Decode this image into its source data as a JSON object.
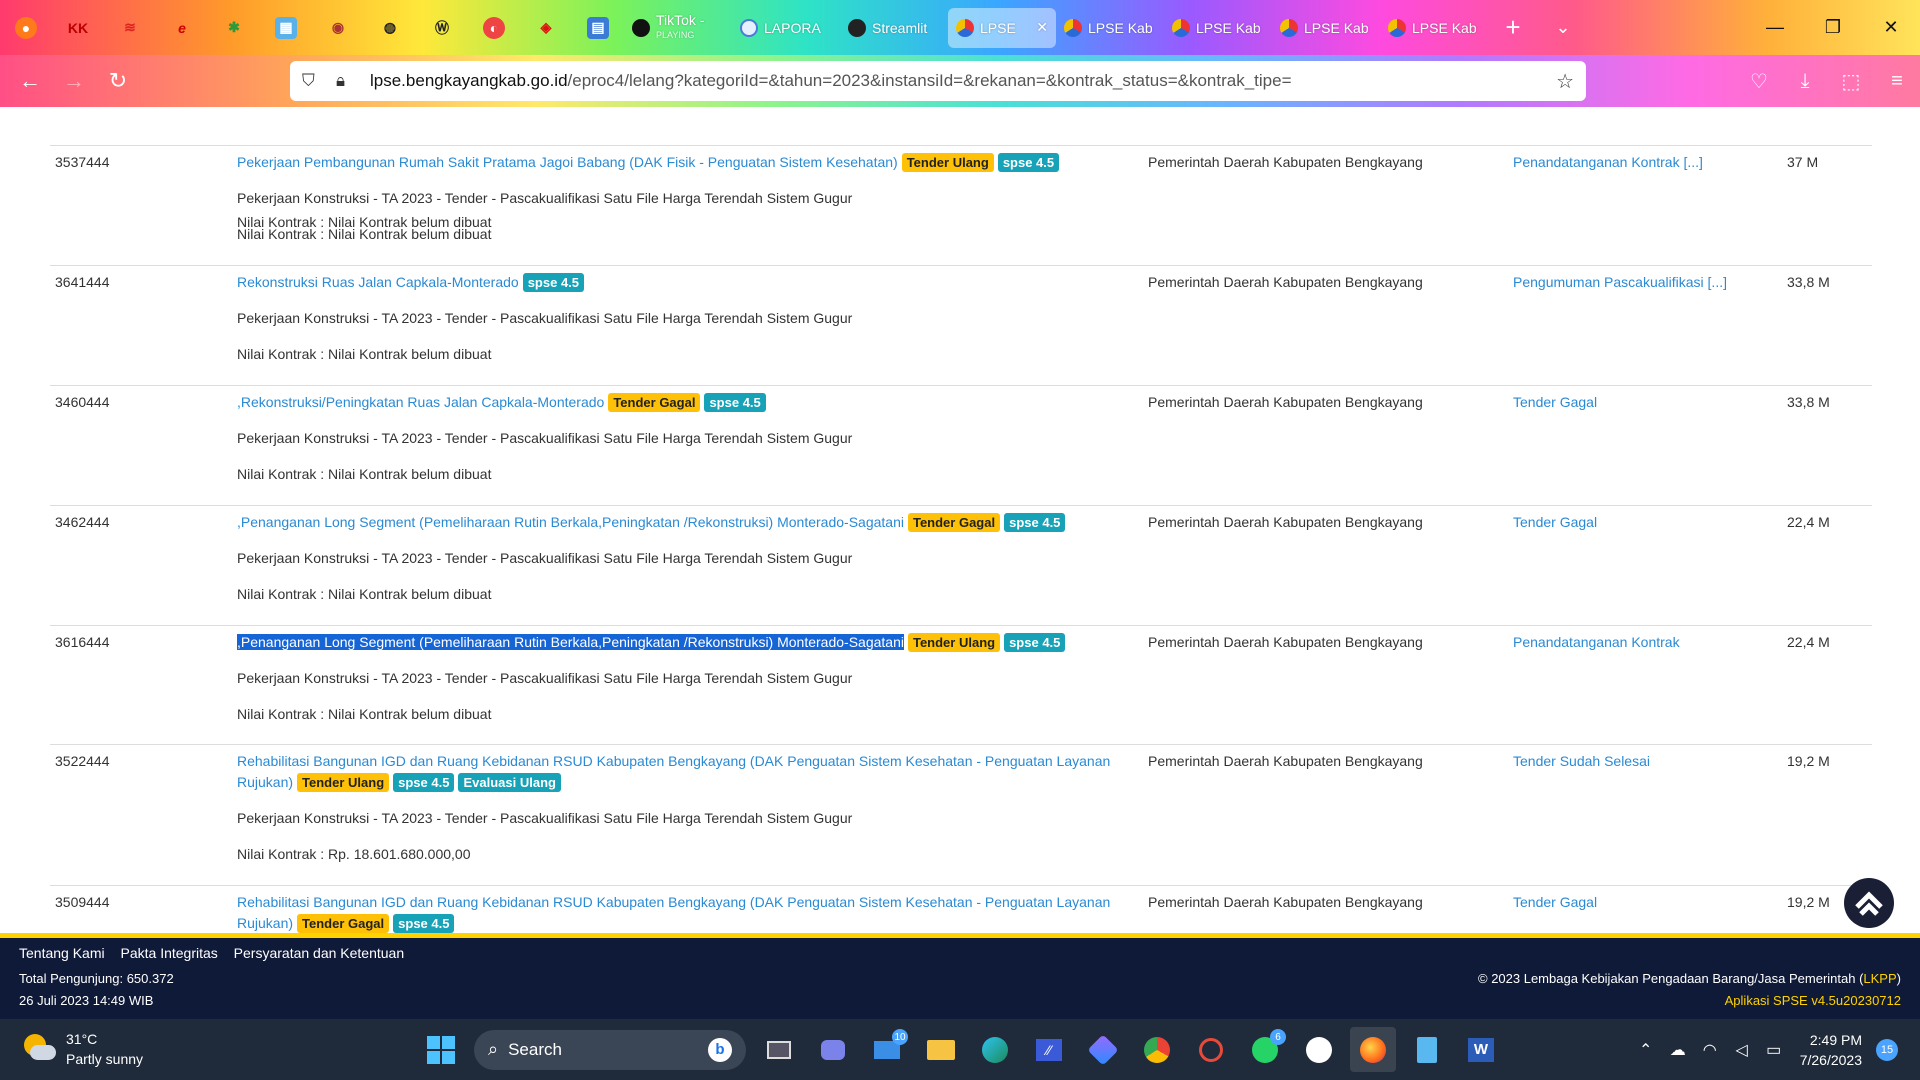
{
  "browser": {
    "tabs": [
      {
        "label": "TikTok - ",
        "sub": "PLAYING",
        "active": false
      },
      {
        "label": "LAPORA",
        "active": false
      },
      {
        "label": "Streamlit",
        "active": false
      },
      {
        "label": "LPSE",
        "active": true
      },
      {
        "label": "LPSE Kab",
        "active": false
      },
      {
        "label": "LPSE Kab",
        "active": false
      },
      {
        "label": "LPSE Kab",
        "active": false
      },
      {
        "label": "LPSE Kab",
        "active": false
      }
    ],
    "url_host": "lpse.bengkayangkab.go.id",
    "url_path": "/eproc4/lelang?kategoriId=&tahun=2023&instansiId=&rekanan=&kontrak_status=&kontrak_tipe="
  },
  "rows": [
    {
      "id": "",
      "name": "",
      "badges": [],
      "desc": "",
      "nilai": "Nilai Kontrak : Nilai Kontrak belum dibuat",
      "instansi": "",
      "tahap": "",
      "hps": ""
    },
    {
      "id": "3537444",
      "name": "Pekerjaan Pembangunan Rumah Sakit Pratama Jagoi Babang (DAK Fisik - Penguatan Sistem Kesehatan)",
      "badges": [
        "Tender Ulang",
        "spse 4.5"
      ],
      "desc": "Pekerjaan Konstruksi - TA 2023 - Tender - Pascakualifikasi Satu File Harga Terendah Sistem Gugur",
      "nilai": "Nilai Kontrak : Nilai Kontrak belum dibuat",
      "instansi": "Pemerintah Daerah Kabupaten Bengkayang",
      "tahap": "Penandatanganan Kontrak [...]",
      "hps": "37 M"
    },
    {
      "id": "3641444",
      "name": "Rekonstruksi Ruas Jalan Capkala-Monterado",
      "badges": [
        "spse 4.5"
      ],
      "desc": "Pekerjaan Konstruksi - TA 2023 - Tender - Pascakualifikasi Satu File Harga Terendah Sistem Gugur",
      "nilai": "Nilai Kontrak : Nilai Kontrak belum dibuat",
      "instansi": "Pemerintah Daerah Kabupaten Bengkayang",
      "tahap": "Pengumuman Pascakualifikasi [...]",
      "hps": "33,8 M"
    },
    {
      "id": "3460444",
      "name": ",Rekonstruksi/Peningkatan Ruas Jalan Capkala-Monterado",
      "badges": [
        "Tender Gagal",
        "spse 4.5"
      ],
      "desc": "Pekerjaan Konstruksi - TA 2023 - Tender - Pascakualifikasi Satu File Harga Terendah Sistem Gugur",
      "nilai": "Nilai Kontrak : Nilai Kontrak belum dibuat",
      "instansi": "Pemerintah Daerah Kabupaten Bengkayang",
      "tahap": "Tender Gagal",
      "hps": "33,8 M"
    },
    {
      "id": "3462444",
      "name": ",Penanganan Long Segment (Pemeliharaan Rutin Berkala,Peningkatan /Rekonstruksi) Monterado-Sagatani",
      "badges": [
        "Tender Gagal",
        "spse 4.5"
      ],
      "desc": "Pekerjaan Konstruksi - TA 2023 - Tender - Pascakualifikasi Satu File Harga Terendah Sistem Gugur",
      "nilai": "Nilai Kontrak : Nilai Kontrak belum dibuat",
      "instansi": "Pemerintah Daerah Kabupaten Bengkayang",
      "tahap": "Tender Gagal",
      "hps": "22,4 M"
    },
    {
      "id": "3616444",
      "name": ",Penanganan Long Segment (Pemeliharaan Rutin Berkala,Peningkatan /Rekonstruksi) Monterado-Sagatani",
      "badges": [
        "Tender Ulang",
        "spse 4.5"
      ],
      "desc": "Pekerjaan Konstruksi - TA 2023 - Tender - Pascakualifikasi Satu File Harga Terendah Sistem Gugur",
      "nilai": "Nilai Kontrak : Nilai Kontrak belum dibuat",
      "instansi": "Pemerintah Daerah Kabupaten Bengkayang",
      "tahap": "Penandatanganan Kontrak",
      "hps": "22,4 M"
    },
    {
      "id": "3522444",
      "name": "Rehabilitasi Bangunan IGD dan Ruang Kebidanan RSUD Kabupaten Bengkayang (DAK Penguatan Sistem Kesehatan - Penguatan Layanan Rujukan)",
      "badges": [
        "Tender Ulang",
        "spse 4.5",
        "Evaluasi Ulang"
      ],
      "desc": "Pekerjaan Konstruksi - TA 2023 - Tender - Pascakualifikasi Satu File Harga Terendah Sistem Gugur",
      "nilai": "Nilai Kontrak : Rp. 18.601.680.000,00",
      "instansi": "Pemerintah Daerah Kabupaten Bengkayang",
      "tahap": "Tender Sudah Selesai",
      "hps": "19,2 M"
    },
    {
      "id": "3509444",
      "name": "Rehabilitasi Bangunan IGD dan Ruang Kebidanan RSUD Kabupaten Bengkayang (DAK Penguatan Sistem Kesehatan - Penguatan Layanan Rujukan)",
      "badges": [
        "Tender Gagal",
        "spse 4.5"
      ],
      "desc": "",
      "nilai": "",
      "instansi": "Pemerintah Daerah Kabupaten Bengkayang",
      "tahap": "Tender Gagal",
      "hps": "19,2 M"
    }
  ],
  "footer": {
    "links": [
      "Tentang Kami",
      "Pakta Integritas",
      "Persyaratan dan Ketentuan"
    ],
    "visitors": "Total Pengunjung: 650.372",
    "date": "26 Juli 2023 14:49 WIB",
    "copyright_prefix": "© 2023 Lembaga Kebijakan Pengadaan Barang/Jasa Pemerintah (",
    "copyright_lkpp": "LKPP",
    "copyright_suffix": ")",
    "version": "Aplikasi SPSE v4.5u20230712"
  },
  "taskbar": {
    "temp": "31°C",
    "weather": "Partly sunny",
    "search": "Search",
    "mail_badge": "10",
    "whatsapp_badge": "6",
    "time": "2:49 PM",
    "date": "7/26/2023",
    "notifications": "15"
  }
}
